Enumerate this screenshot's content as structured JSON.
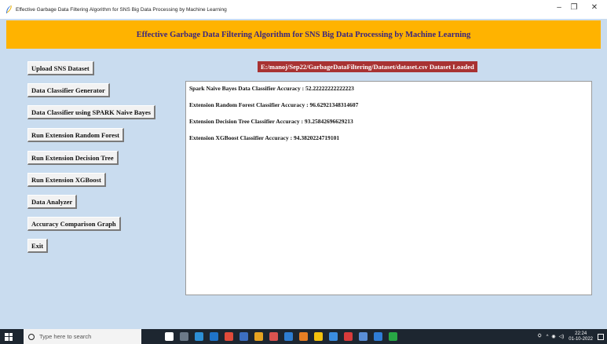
{
  "window": {
    "title": "Effective Garbage Data Filtering Algorithm for SNS Big Data Processing by Machine Learning",
    "minimize": "–",
    "maximize": "❐",
    "close": "✕"
  },
  "banner": {
    "text": "Effective Garbage Data Filtering Algorithm for SNS Big Data Processing by Machine Learning",
    "color": "#ffb300"
  },
  "buttons": {
    "upload": "Upload SNS Dataset",
    "classifier_generator": "Data Classifier Generator",
    "spark_nb": "Data Classifier using SPARK Naive Bayes",
    "random_forest": "Run Extension Random Forest",
    "decision_tree": "Run Extension Decision Tree",
    "xgboost": "Run Extension XGBoost",
    "analyzer": "Data Analyzer",
    "accuracy_graph": "Accuracy Comparison Graph",
    "exit": "Exit"
  },
  "status": {
    "text": "E:/manoj/Sep22/GarbageDataFiltering/Dataset/dataset.csv Dataset Loaded",
    "color": "#a83232"
  },
  "output": {
    "lines": [
      "Spark Naive Bayes Data Classifier Accuracy : 52.22222222222223",
      "Extension Random Forest Classifier Accuracy : 96.62921348314607",
      "Extension Decision Tree Classifier Accuracy : 93.25842696629213",
      "Extension XGBoost Classifier Accuracy : 94.3820224719101"
    ]
  },
  "taskbar": {
    "search_placeholder": "Type here to search",
    "time": "22:24",
    "date": "01-10-2022"
  }
}
